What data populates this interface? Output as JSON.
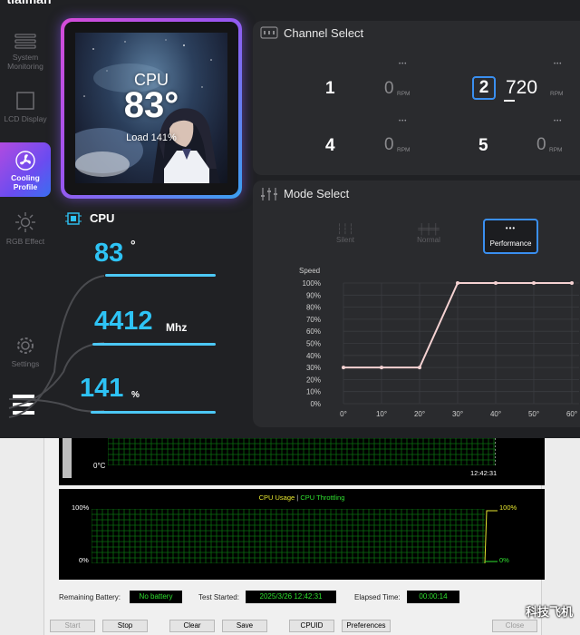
{
  "app": {
    "brand": "tlalman",
    "sidebar": [
      {
        "label": "System\nMonitoring",
        "icon": "sliders-icon"
      },
      {
        "label": "LCD Display",
        "icon": "square-icon"
      },
      {
        "label": "Cooling\nProfile",
        "icon": "fan-icon",
        "active": true
      },
      {
        "label": "RGB Effect",
        "icon": "sun-icon"
      },
      {
        "label": "Settings",
        "icon": "gear-icon"
      }
    ],
    "preview": {
      "label": "CPU",
      "temp": "83°",
      "load": "Load 141%"
    },
    "cpu_panel": {
      "title": "CPU",
      "temp": "83",
      "temp_unit": "°",
      "freq": "4412",
      "freq_unit": "Mhz",
      "load": "141",
      "load_unit": "%"
    },
    "channel_select": {
      "title": "Channel Select",
      "rpm_unit": "RPM",
      "channels": [
        {
          "num": "1",
          "value": "0"
        },
        {
          "num": "2",
          "value": "720",
          "selected": true
        },
        {
          "num": "4",
          "value": "0"
        },
        {
          "num": "5",
          "value": "0"
        }
      ]
    },
    "mode_select": {
      "title": "Mode Select",
      "modes": [
        {
          "label": "Silent"
        },
        {
          "label": "Normal"
        },
        {
          "label": "Performance",
          "active": true
        }
      ]
    }
  },
  "chart_data": {
    "type": "line",
    "ylabel": "Speed",
    "x_ticks": [
      "0°",
      "10°",
      "20°",
      "30°",
      "40°",
      "50°",
      "60°"
    ],
    "y_ticks": [
      "0%",
      "10%",
      "20%",
      "30%",
      "40%",
      "50%",
      "60%",
      "70%",
      "80%",
      "90%",
      "100%"
    ],
    "x": [
      0,
      10,
      20,
      30,
      40,
      50,
      60
    ],
    "y": [
      30,
      30,
      30,
      100,
      100,
      100,
      100
    ],
    "xlim": [
      0,
      60
    ],
    "ylim": [
      0,
      100
    ],
    "line_color": "#f5d2d2",
    "grid": true
  },
  "monitor": {
    "temp_graph": {
      "y_label": "0°C",
      "time": "12:42:31"
    },
    "usage_graph": {
      "legend_usage": "CPU Usage",
      "legend_sep": "|",
      "legend_throttle": "CPU Throttling",
      "left_top": "100%",
      "left_bottom": "0%",
      "right_top": "100%",
      "right_bottom": "0%"
    },
    "status": {
      "battery_label": "Remaining Battery:",
      "battery_value": "No battery",
      "started_label": "Test Started:",
      "started_value": "2025/3/26 12:42:31",
      "elapsed_label": "Elapsed Time:",
      "elapsed_value": "00:00:14"
    },
    "buttons": {
      "start": "Start",
      "stop": "Stop",
      "clear": "Clear",
      "save": "Save",
      "cpuid": "CPUID",
      "preferences": "Preferences",
      "close": "Close"
    }
  },
  "watermark": "科技飞机"
}
